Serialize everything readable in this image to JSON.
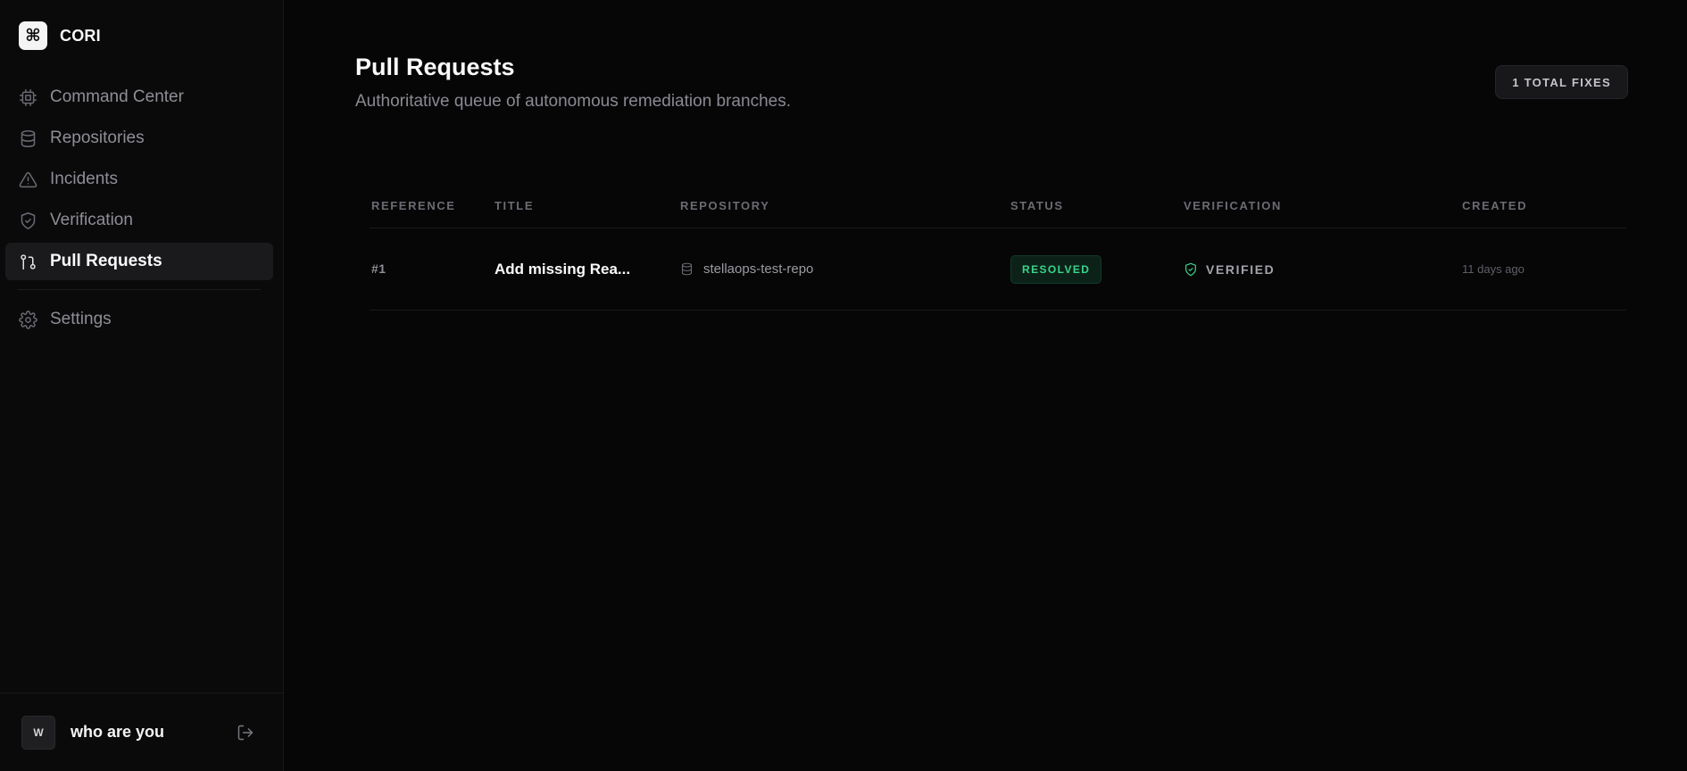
{
  "app": {
    "logo_glyph": "⌘",
    "name": "CORI"
  },
  "sidebar": {
    "items": [
      {
        "label": "Command Center",
        "icon": "cpu-icon",
        "active": false
      },
      {
        "label": "Repositories",
        "icon": "database-icon",
        "active": false
      },
      {
        "label": "Incidents",
        "icon": "warning-triangle-icon",
        "active": false
      },
      {
        "label": "Verification",
        "icon": "shield-check-icon",
        "active": false
      },
      {
        "label": "Pull Requests",
        "icon": "git-pull-request-icon",
        "active": true
      }
    ],
    "settings": {
      "label": "Settings",
      "icon": "gear-icon"
    }
  },
  "user": {
    "initial": "W",
    "name": "who are you",
    "logout_icon": "logout-icon"
  },
  "page": {
    "title": "Pull Requests",
    "subtitle": "Authoritative queue of autonomous remediation branches.",
    "total_badge": "1 TOTAL FIXES"
  },
  "table": {
    "columns": [
      "REFERENCE",
      "TITLE",
      "REPOSITORY",
      "STATUS",
      "VERIFICATION",
      "CREATED"
    ],
    "rows": [
      {
        "reference": "#1",
        "title": "Add missing Rea...",
        "repository": "stellaops-test-repo",
        "status": "RESOLVED",
        "verification": "VERIFIED",
        "created": "11 days ago"
      }
    ]
  },
  "colors": {
    "background": "#060607",
    "sidebar": "#0a0a0b",
    "accent_green": "#3ad48a",
    "active_nav": "#1a1a1d"
  }
}
